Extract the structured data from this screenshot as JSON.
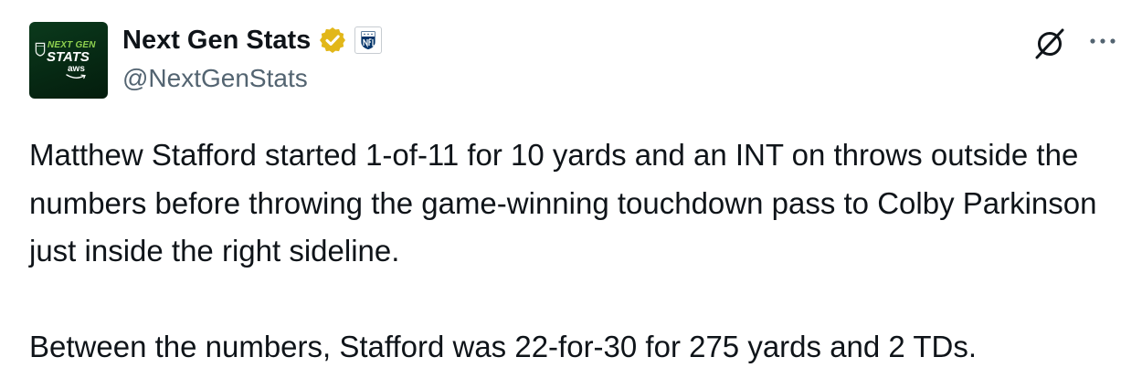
{
  "author": {
    "display_name": "Next Gen Stats",
    "handle": "@NextGenStats",
    "verified_badge_color": "#e2b719",
    "affiliate_badge": "nfl-shield-icon",
    "avatar": {
      "brand_top": "NEXT GEN",
      "brand_main": "STATS",
      "brand_sponsor": "aws",
      "background_color": "#062813",
      "accent_color": "#8fd14f"
    }
  },
  "actions": {
    "grok_icon": "grok-slash-circle-icon",
    "more_icon": "more-dots-icon"
  },
  "tweet": {
    "paragraphs": [
      "Matthew Stafford started 1-of-11 for 10 yards and an INT on throws outside the numbers before throwing the game-winning touchdown pass to Colby Parkinson just inside the right sideline.",
      "Between the numbers, Stafford was 22-for-30 for 275 yards and 2 TDs."
    ]
  },
  "colors": {
    "text_primary": "#0f1419",
    "text_secondary": "#536471"
  }
}
